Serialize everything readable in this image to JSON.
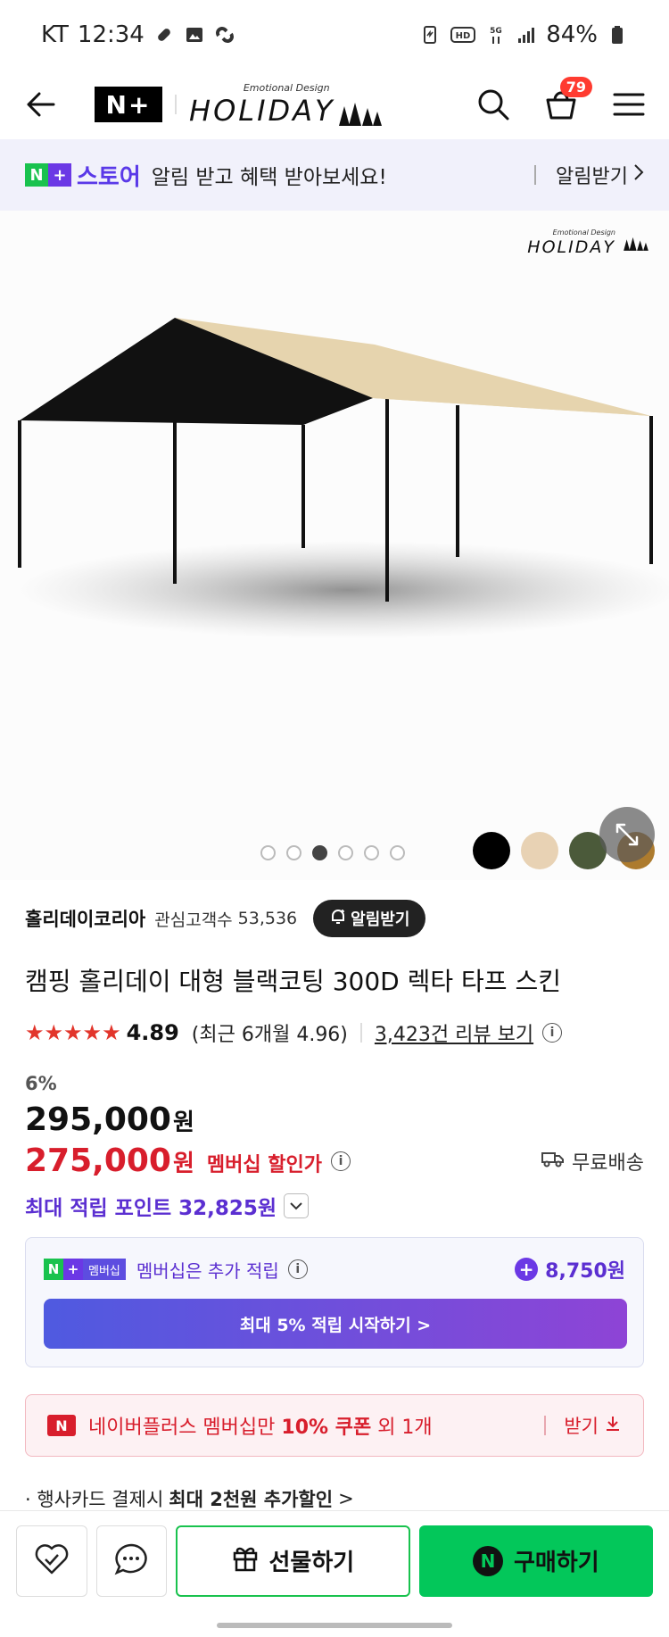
{
  "status": {
    "carrier": "KT",
    "time": "12:34",
    "battery": "84%"
  },
  "header": {
    "nplus_logo": "N+",
    "brand_sub": "Emotional Design",
    "brand_main": "HOLIDAY",
    "cart_count": "79"
  },
  "banner": {
    "store_name": "스토어",
    "text": "알림 받고 혜택 받아보세요!",
    "action": "알림받기"
  },
  "image": {
    "brand_sub": "Emotional Design",
    "brand_main": "HOLIDAY",
    "swatch_colors": [
      "#000000",
      "#e8d2b4",
      "#4b5a3a",
      "#ad7b2e"
    ],
    "active_dot": 3,
    "dot_count": 6
  },
  "seller": {
    "name": "홀리데이코리아",
    "fan_label": "관심고객수",
    "fan_count": "53,536",
    "alarm_label": "알림받기"
  },
  "product": {
    "title": "캠핑 홀리데이 대형 블랙코팅 300D 렉타 타프 스킨",
    "stars": "★★★★★",
    "rating": "4.89",
    "rating_recent": "(최근 6개월 4.96)",
    "review_link": "3,423건 리뷰 보기",
    "discount": "6%",
    "original_price": "295,000",
    "won": "원",
    "member_price": "275,000",
    "member_label": "멤버십 할인가",
    "shipping": "무료배송",
    "points": "최대 적립 포인트 32,825원"
  },
  "membership": {
    "badge_n": "N",
    "badge_plus": "+",
    "badge_text": "멤버십",
    "text": "멤버십은 추가 적립",
    "amount": "8,750원",
    "button": "최대 5% 적립 시작하기 >"
  },
  "coupon": {
    "icon": "N",
    "text_prefix": "네이버플러스 멤버십만 ",
    "text_bold": "10% 쿠폰",
    "text_suffix": " 외 1개",
    "action": "받기"
  },
  "card_promo": {
    "prefix": "· 행사카드 결제시 ",
    "bold": "최대 2천원 추가할인",
    "arrow": ">"
  },
  "bottom": {
    "gift": "선물하기",
    "buy": "구매하기"
  }
}
